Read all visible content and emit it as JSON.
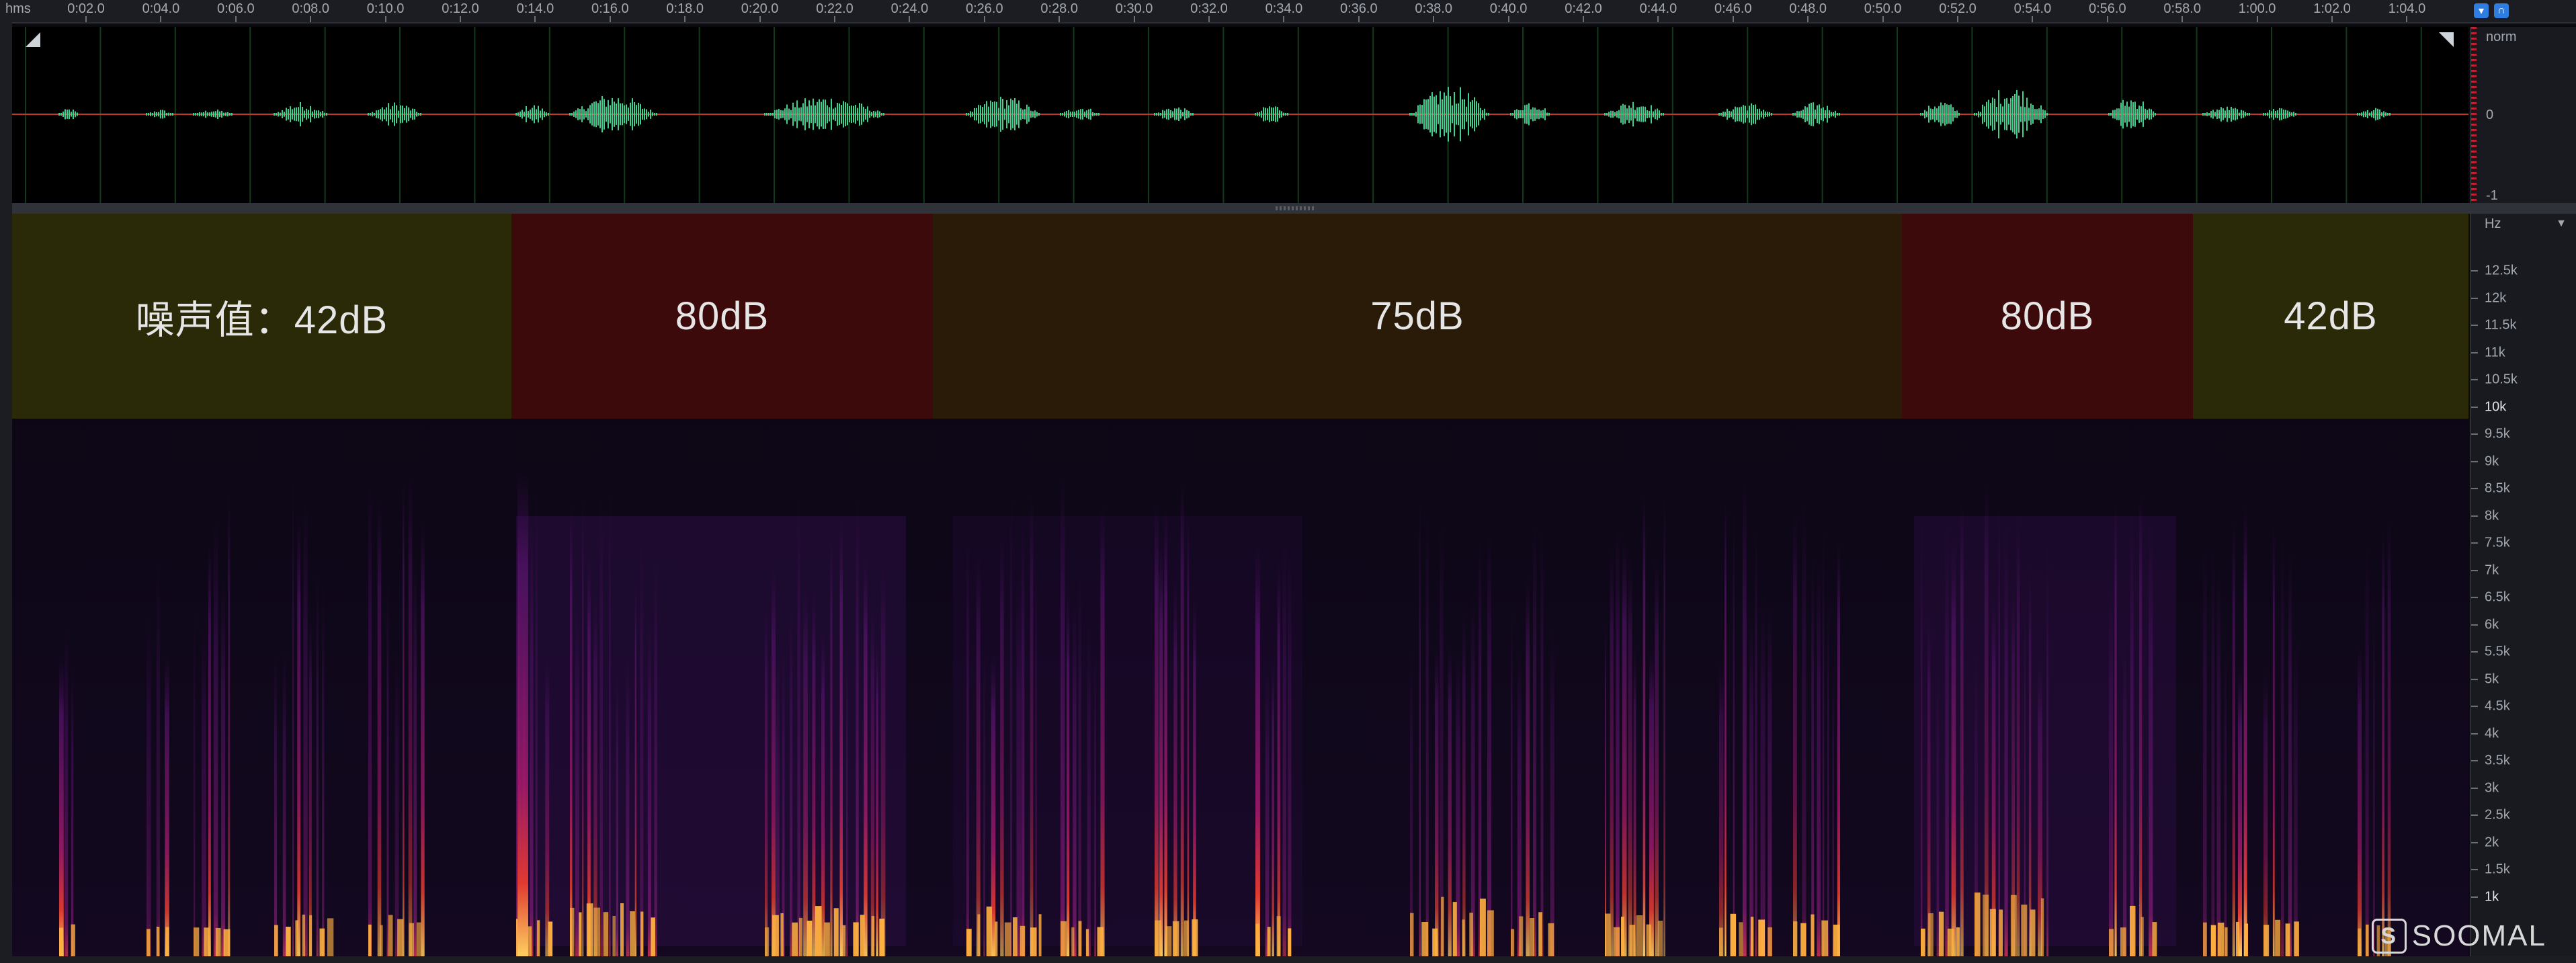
{
  "ruler": {
    "unit_label": "hms",
    "ticks": [
      "0:02.0",
      "0:04.0",
      "0:06.0",
      "0:08.0",
      "0:10.0",
      "0:12.0",
      "0:14.0",
      "0:16.0",
      "0:18.0",
      "0:20.0",
      "0:22.0",
      "0:24.0",
      "0:26.0",
      "0:28.0",
      "0:30.0",
      "0:32.0",
      "0:34.0",
      "0:36.0",
      "0:38.0",
      "0:40.0",
      "0:42.0",
      "0:44.0",
      "0:46.0",
      "0:48.0",
      "0:50.0",
      "0:52.0",
      "0:54.0",
      "0:56.0",
      "0:58.0",
      "1:00.0",
      "1:02.0",
      "1:04.0"
    ]
  },
  "waveform": {
    "scale": {
      "top": "norm",
      "mid": "0",
      "bottom": "-1"
    },
    "colors": {
      "wave": "#3fcf8e",
      "center_line": "#c0392b",
      "grid": "#123a1a"
    }
  },
  "noise_zones": [
    {
      "label": "噪声值：42dB",
      "color": "#2b2a08"
    },
    {
      "label": "80dB",
      "color": "#3d0a0c"
    },
    {
      "label": "75dB",
      "color": "#2a1a08"
    },
    {
      "label": "80dB",
      "color": "#3d0a0c"
    },
    {
      "label": "42dB",
      "color": "#2b2a08"
    }
  ],
  "freq_scale": {
    "unit": "Hz",
    "labels": [
      "12.5k",
      "12k",
      "11.5k",
      "11k",
      "10.5k",
      "10k",
      "9.5k",
      "9k",
      "8.5k",
      "8k",
      "7.5k",
      "7k",
      "6.5k",
      "6k",
      "5.5k",
      "5k",
      "4.5k",
      "4k",
      "3.5k",
      "3k",
      "2.5k",
      "2k",
      "1.5k",
      "1k"
    ]
  },
  "watermark": {
    "logo": "S",
    "text": "SOOMAL"
  },
  "icons": {
    "ruler_handles": [
      "marker-icon",
      "headphone-icon"
    ],
    "corners": [
      "zoom-corner-left-icon",
      "zoom-corner-right-icon"
    ],
    "dropdown": "chevron-down-icon"
  }
}
